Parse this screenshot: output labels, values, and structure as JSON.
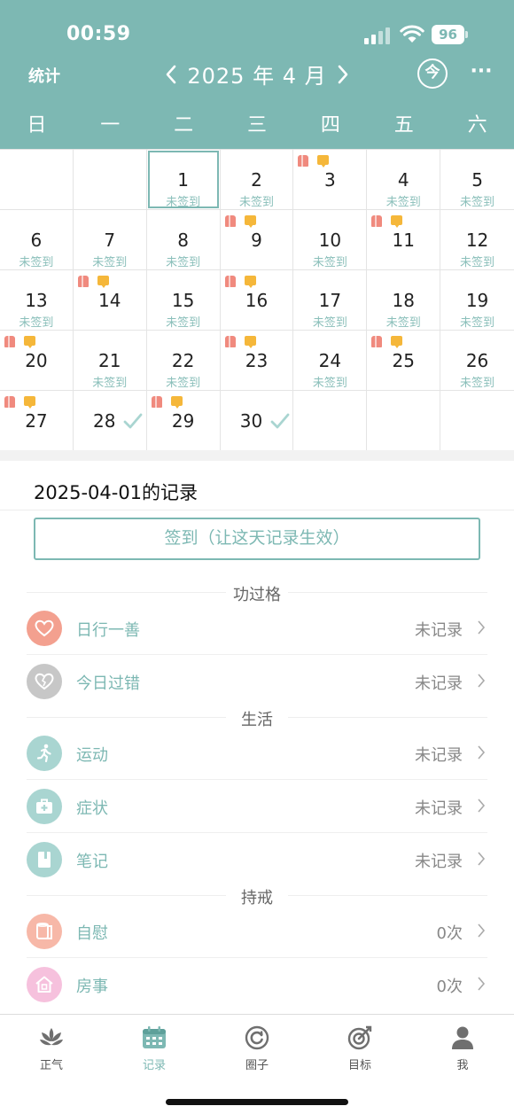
{
  "status_bar": {
    "time": "00:59",
    "battery": "96"
  },
  "header": {
    "stats_label": "统计",
    "month_title": "2025 年 4 月",
    "today_label": "今",
    "more_label": "···"
  },
  "weekdays": [
    "日",
    "一",
    "二",
    "三",
    "四",
    "五",
    "六"
  ],
  "calendar": {
    "unsigned_label": "未签到",
    "days": [
      {
        "n": "1",
        "unsigned": true,
        "selected": true
      },
      {
        "n": "2",
        "unsigned": true
      },
      {
        "n": "3",
        "red": true,
        "yellow": true
      },
      {
        "n": "4",
        "unsigned": true
      },
      {
        "n": "5",
        "unsigned": true
      },
      {
        "n": "6",
        "unsigned": true
      },
      {
        "n": "7",
        "unsigned": true
      },
      {
        "n": "8",
        "unsigned": true
      },
      {
        "n": "9",
        "red": true,
        "yellow": true
      },
      {
        "n": "10",
        "unsigned": true
      },
      {
        "n": "11",
        "red": true,
        "yellow": true
      },
      {
        "n": "12",
        "unsigned": true
      },
      {
        "n": "13",
        "unsigned": true
      },
      {
        "n": "14",
        "red": true,
        "yellow": true
      },
      {
        "n": "15",
        "unsigned": true
      },
      {
        "n": "16",
        "red": true,
        "yellow": true
      },
      {
        "n": "17",
        "unsigned": true
      },
      {
        "n": "18",
        "unsigned": true
      },
      {
        "n": "19",
        "unsigned": true
      },
      {
        "n": "20",
        "red": true,
        "yellow": true
      },
      {
        "n": "21",
        "unsigned": true
      },
      {
        "n": "22",
        "unsigned": true
      },
      {
        "n": "23",
        "red": true,
        "yellow": true
      },
      {
        "n": "24",
        "unsigned": true
      },
      {
        "n": "25",
        "red": true,
        "yellow": true
      },
      {
        "n": "26",
        "unsigned": true
      },
      {
        "n": "27",
        "red": true,
        "yellow": true
      },
      {
        "n": "28",
        "checked": true
      },
      {
        "n": "29",
        "red": true,
        "yellow": true
      },
      {
        "n": "30",
        "checked": true
      }
    ]
  },
  "record": {
    "title": "2025-04-01的记录",
    "signin_label": "签到（让这天记录生效）"
  },
  "sections": [
    {
      "title": "功过格",
      "items": [
        {
          "label": "日行一善",
          "value": "未记录",
          "icon": "heart-icon",
          "color": "#f3a08f"
        },
        {
          "label": "今日过错",
          "value": "未记录",
          "icon": "broken-heart-icon",
          "color": "#c7c7c7"
        }
      ]
    },
    {
      "title": "生活",
      "items": [
        {
          "label": "运动",
          "value": "未记录",
          "icon": "running-icon",
          "color": "#a9d5d1"
        },
        {
          "label": "症状",
          "value": "未记录",
          "icon": "medical-kit-icon",
          "color": "#a9d5d1"
        },
        {
          "label": "笔记",
          "value": "未记录",
          "icon": "notebook-icon",
          "color": "#a9d5d1"
        }
      ]
    },
    {
      "title": "持戒",
      "items": [
        {
          "label": "自慰",
          "value": "0次",
          "icon": "tissue-icon",
          "color": "#f7b8a8"
        },
        {
          "label": "房事",
          "value": "0次",
          "icon": "house-icon",
          "color": "#f6c1dd"
        }
      ]
    }
  ],
  "tabs": [
    {
      "label": "正气",
      "icon": "lotus-icon"
    },
    {
      "label": "记录",
      "icon": "calendar-icon",
      "active": true
    },
    {
      "label": "圈子",
      "icon": "circle-refresh-icon"
    },
    {
      "label": "目标",
      "icon": "target-icon"
    },
    {
      "label": "我",
      "icon": "person-icon"
    }
  ],
  "colors": {
    "accent": "#7db8b3",
    "marker_red": "#f08a7e",
    "marker_yellow": "#f5b73a"
  }
}
